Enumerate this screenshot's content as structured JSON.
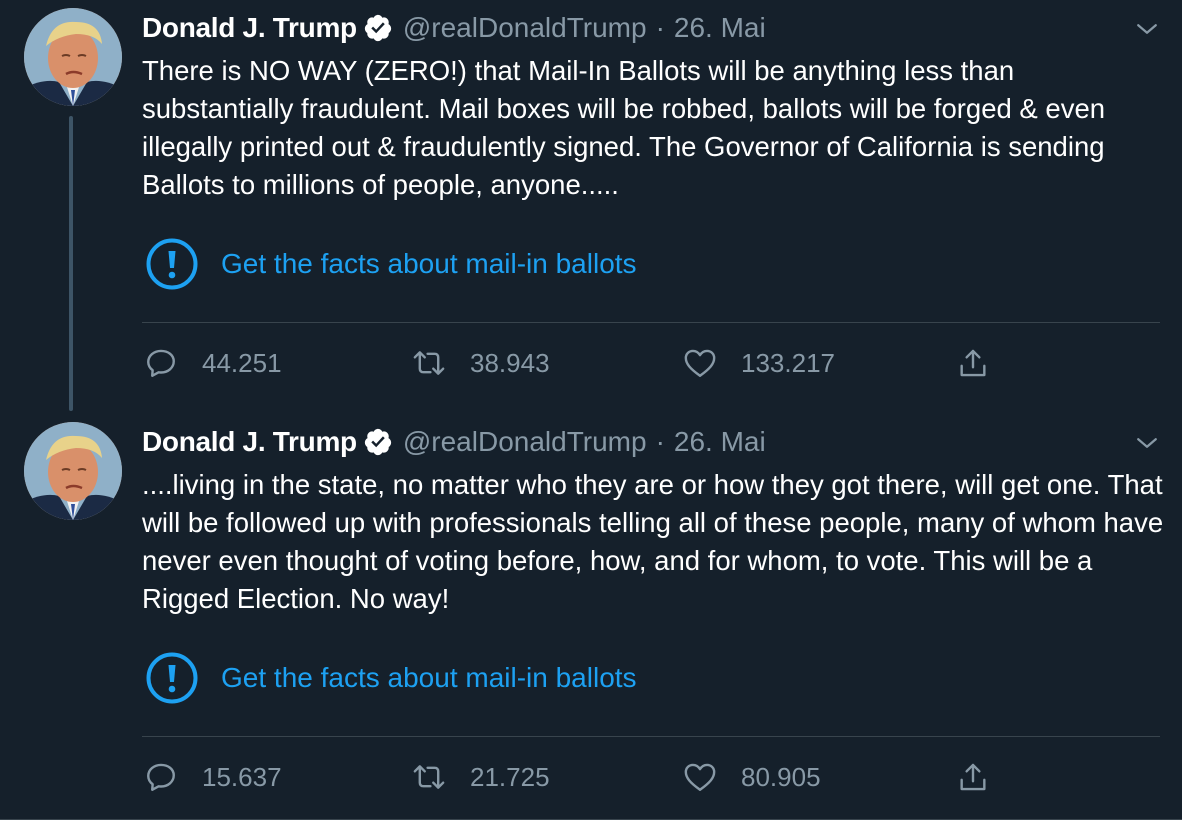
{
  "tweets": [
    {
      "author_name": "Donald J. Trump",
      "handle": "@realDonaldTrump",
      "separator": "·",
      "date": "26. Mai",
      "text": "There is NO WAY (ZERO!) that Mail-In Ballots will be anything less than substantially fraudulent. Mail boxes will be robbed, ballots will be forged & even illegally printed out & fraudulently signed. The Governor of California is sending Ballots to millions of people, anyone.....",
      "facts_label": "Get the facts about mail-in ballots",
      "replies": "44.251",
      "retweets": "38.943",
      "likes": "133.217"
    },
    {
      "author_name": "Donald J. Trump",
      "handle": "@realDonaldTrump",
      "separator": "·",
      "date": "26. Mai",
      "text": "....living in the state, no matter who they are or how they got there, will get one. That will be followed up with professionals telling all of these people, many of whom have never even thought of voting before, how, and for whom, to vote. This will be a Rigged Election. No way!",
      "facts_label": "Get the facts about mail-in ballots",
      "replies": "15.637",
      "retweets": "21.725",
      "likes": "80.905"
    }
  ],
  "icons": {
    "verified": "verified-badge-icon",
    "caret": "chevron-down-icon",
    "alert": "exclamation-circle-icon",
    "reply": "reply-bubble-icon",
    "retweet": "retweet-icon",
    "like": "heart-icon",
    "share": "share-upload-icon"
  },
  "colors": {
    "background": "#15202b",
    "text": "#ffffff",
    "secondary_text": "#8899a6",
    "accent": "#1da1f2",
    "divider": "#38444d",
    "thread_line": "#3d5466"
  }
}
